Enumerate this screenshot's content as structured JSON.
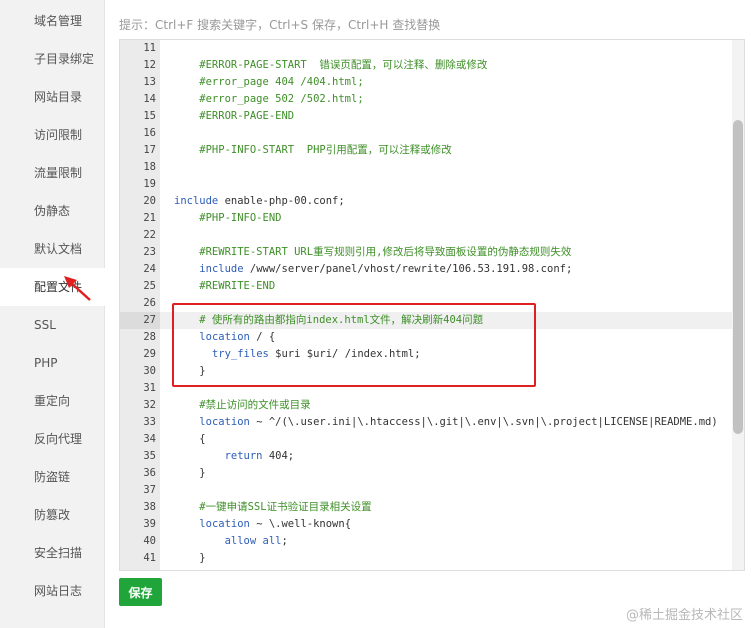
{
  "sidebar": {
    "items": [
      {
        "label": "域名管理"
      },
      {
        "label": "子目录绑定"
      },
      {
        "label": "网站目录"
      },
      {
        "label": "访问限制"
      },
      {
        "label": "流量限制"
      },
      {
        "label": "伪静态"
      },
      {
        "label": "默认文档"
      },
      {
        "label": "配置文件",
        "active": true
      },
      {
        "label": "SSL"
      },
      {
        "label": "PHP"
      },
      {
        "label": "重定向"
      },
      {
        "label": "反向代理"
      },
      {
        "label": "防盗链"
      },
      {
        "label": "防篡改"
      },
      {
        "label": "安全扫描"
      },
      {
        "label": "网站日志"
      }
    ]
  },
  "hint": "提示：Ctrl+F 搜索关键字，Ctrl+S 保存，Ctrl+H 查找替换",
  "editor": {
    "lines": [
      {
        "n": "11",
        "text": ""
      },
      {
        "n": "12",
        "text": "    #ERROR-PAGE-START  错误页配置，可以注释、删除或修改",
        "type": "comment"
      },
      {
        "n": "13",
        "text": "    #error_page 404 /404.html;",
        "type": "comment"
      },
      {
        "n": "14",
        "text": "    #error_page 502 /502.html;",
        "type": "comment"
      },
      {
        "n": "15",
        "text": "    #ERROR-PAGE-END",
        "type": "comment"
      },
      {
        "n": "16",
        "text": ""
      },
      {
        "n": "17",
        "text": "    #PHP-INFO-START  PHP引用配置，可以注释或修改",
        "type": "comment"
      },
      {
        "n": "18",
        "text": ""
      },
      {
        "n": "19",
        "text": ""
      },
      {
        "n": "20",
        "kw": "include",
        "rest": " enable-php-00.conf;"
      },
      {
        "n": "21",
        "text": "    #PHP-INFO-END",
        "type": "comment"
      },
      {
        "n": "22",
        "text": ""
      },
      {
        "n": "23",
        "text": "    #REWRITE-START URL重写规则引用,修改后将导致面板设置的伪静态规则失效",
        "type": "comment"
      },
      {
        "n": "24",
        "indent": "    ",
        "kw": "include",
        "rest": " /www/server/panel/vhost/rewrite/106.53.191.98.conf;"
      },
      {
        "n": "25",
        "text": "    #REWRITE-END",
        "type": "comment"
      },
      {
        "n": "26",
        "text": ""
      },
      {
        "n": "27",
        "text": "    # 使所有的路由都指向index.html文件，解决刷新404问题",
        "type": "comment",
        "active": true
      },
      {
        "n": "28",
        "indent": "    ",
        "kw": "location",
        "rest": " / {"
      },
      {
        "n": "29",
        "indent": "      ",
        "kw": "try_files",
        "rest": " $uri $uri/ /index.html;"
      },
      {
        "n": "30",
        "text": "    }"
      },
      {
        "n": "31",
        "text": ""
      },
      {
        "n": "32",
        "text": "    #禁止访问的文件或目录",
        "type": "comment"
      },
      {
        "n": "33",
        "indent": "    ",
        "kw": "location",
        "rest": " ~ ^/(\\.user.ini|\\.htaccess|\\.git|\\.env|\\.svn|\\.project|LICENSE|README.md)"
      },
      {
        "n": "34",
        "text": "    {"
      },
      {
        "n": "35",
        "indent": "        ",
        "kw": "return",
        "rest": " 404;"
      },
      {
        "n": "36",
        "text": "    }"
      },
      {
        "n": "37",
        "text": ""
      },
      {
        "n": "38",
        "text": "    #一键申请SSL证书验证目录相关设置",
        "type": "comment"
      },
      {
        "n": "39",
        "indent": "    ",
        "kw": "location",
        "rest": " ~ \\.well-known{"
      },
      {
        "n": "40",
        "indent": "        ",
        "kw": "allow all",
        "rest": ";"
      },
      {
        "n": "41",
        "text": "    }"
      }
    ]
  },
  "save_label": "保存",
  "watermark": "@稀土掘金技术社区",
  "colors": {
    "accent": "#20a53a",
    "annotation": "#e02020",
    "comment": "#3e8f28",
    "keyword": "#2e5db8"
  }
}
